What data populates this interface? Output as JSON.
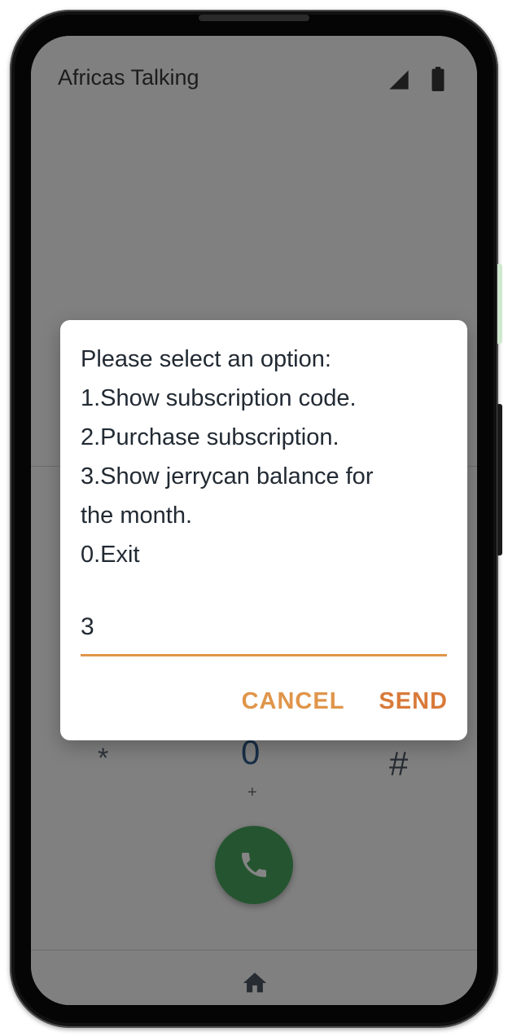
{
  "status_bar": {
    "carrier": "Africas Talking",
    "signal_icon": "cellular-signal-icon",
    "battery_icon": "battery-icon"
  },
  "dialpad": {
    "star_key": "*",
    "zero_key": "0",
    "zero_sub": "+",
    "hash_key": "#",
    "call_icon": "phone-icon",
    "home_icon": "home-icon"
  },
  "dialog": {
    "message_lines": [
      "Please select an option:",
      "1.Show subscription code.",
      "2.Purchase subscription.",
      "3.Show jerrycan balance for",
      "the month.",
      "0.Exit"
    ],
    "input_value": "3",
    "cancel_label": "CANCEL",
    "send_label": "SEND"
  },
  "colors": {
    "accent": "#e0954a",
    "call_green": "#48a35c"
  }
}
